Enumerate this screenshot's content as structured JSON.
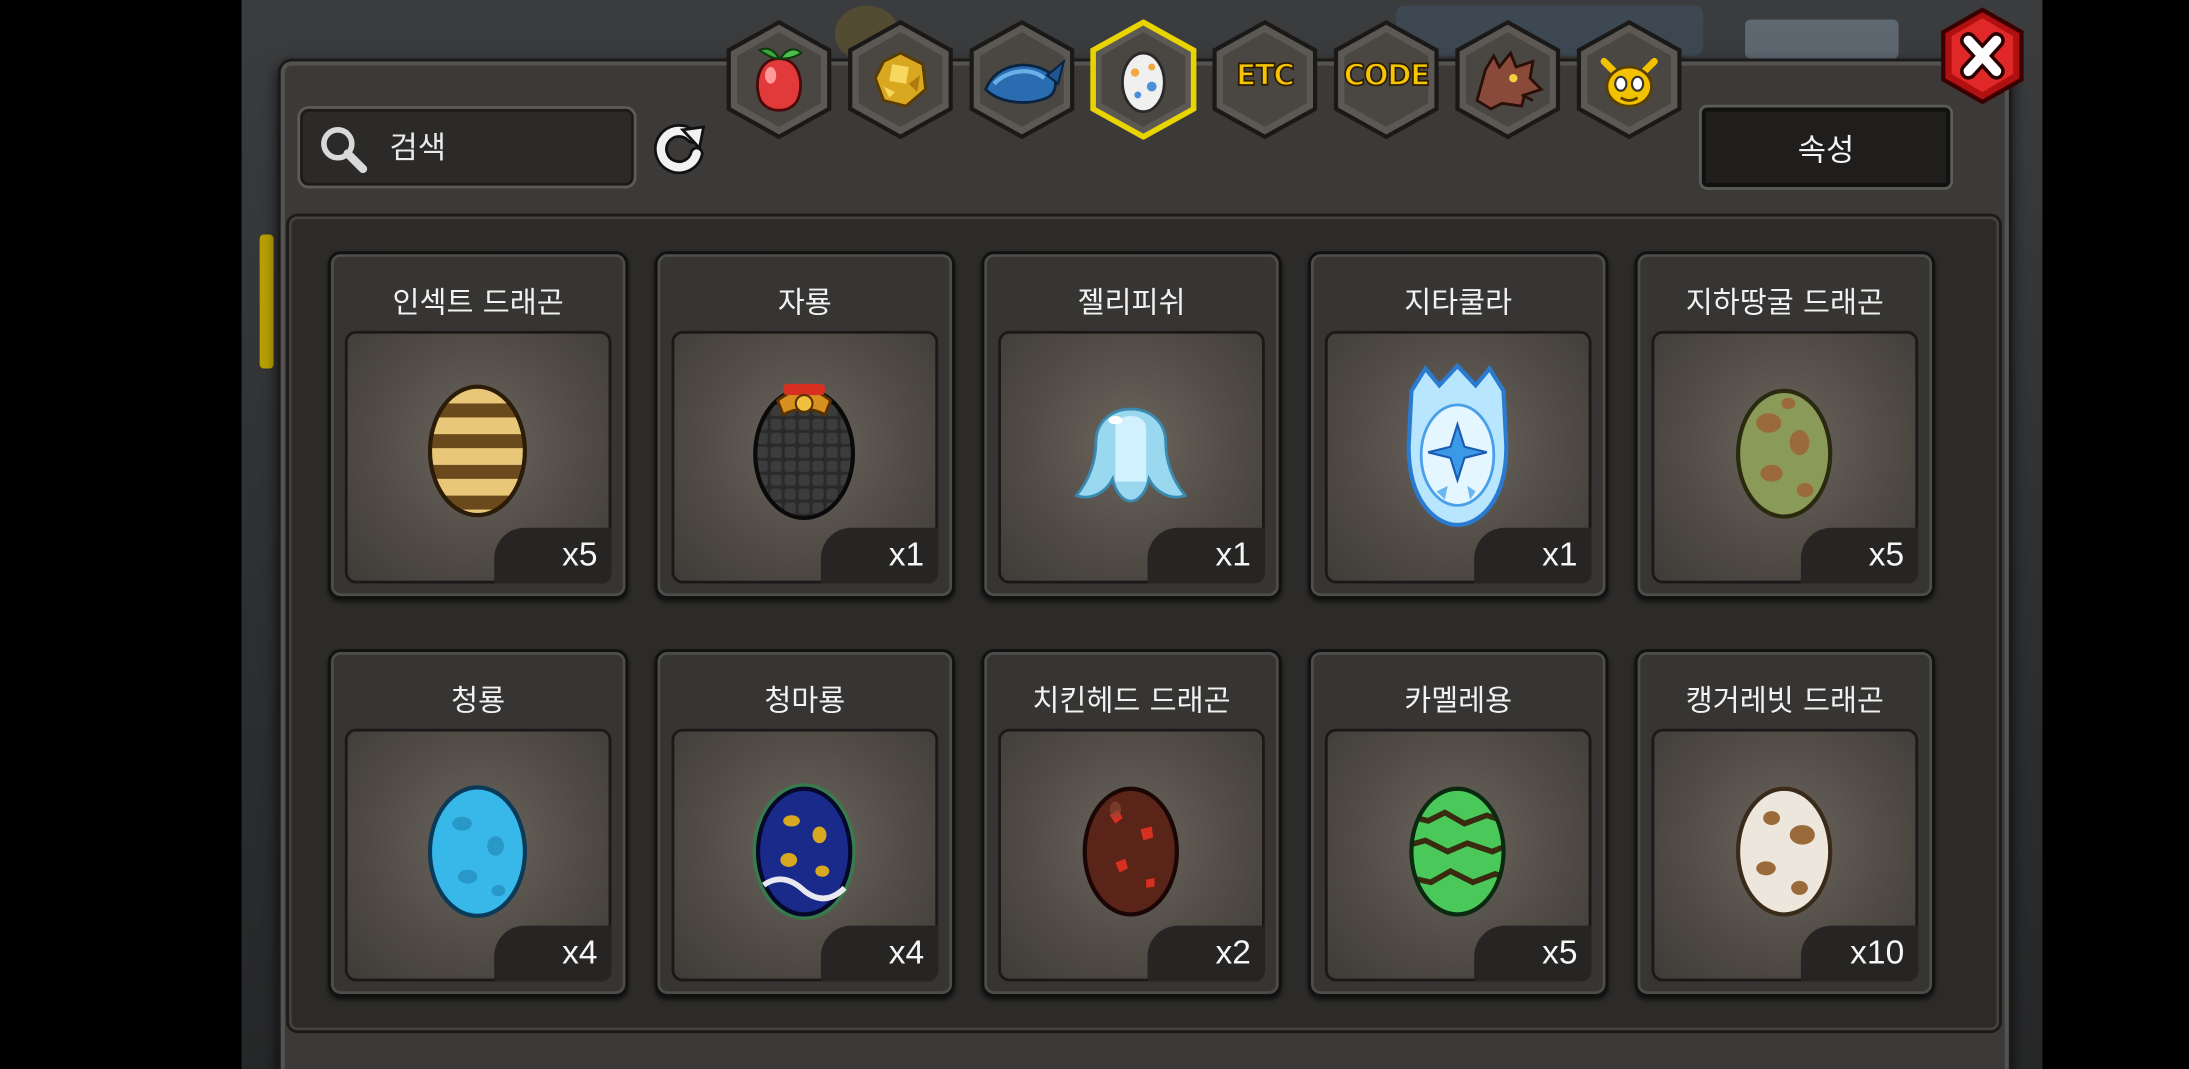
{
  "search": {
    "placeholder": "검색"
  },
  "attribute_button": {
    "label": "속성"
  },
  "tabs": [
    {
      "icon": "fruit-icon"
    },
    {
      "icon": "gold-ore-icon"
    },
    {
      "icon": "blue-fish-icon"
    },
    {
      "icon": "egg-icon",
      "selected": true
    },
    {
      "label": "ETC"
    },
    {
      "label": "CODE"
    },
    {
      "icon": "dragon-head-icon"
    },
    {
      "icon": "horned-mask-icon"
    }
  ],
  "items": [
    {
      "name": "인섹트 드래곤",
      "qty": "x5",
      "egg": "striped-brown-egg-icon"
    },
    {
      "name": "자룡",
      "qty": "x1",
      "egg": "black-scaled-egg-icon"
    },
    {
      "name": "젤리피쉬",
      "qty": "x1",
      "egg": "jellyfish-egg-icon"
    },
    {
      "name": "지타쿨라",
      "qty": "x1",
      "egg": "ice-crystal-egg-icon"
    },
    {
      "name": "지하땅굴 드래곤",
      "qty": "x5",
      "egg": "green-spotted-egg-icon"
    },
    {
      "name": "청룡",
      "qty": "x4",
      "egg": "light-blue-egg-icon"
    },
    {
      "name": "청마룡",
      "qty": "x4",
      "egg": "dark-blue-egg-icon"
    },
    {
      "name": "치킨헤드 드래곤",
      "qty": "x2",
      "egg": "red-brown-egg-icon"
    },
    {
      "name": "카멜레용",
      "qty": "x5",
      "egg": "green-striped-egg-icon"
    },
    {
      "name": "캥거레빗 드래곤",
      "qty": "x10",
      "egg": "white-spotted-egg-icon"
    }
  ]
}
